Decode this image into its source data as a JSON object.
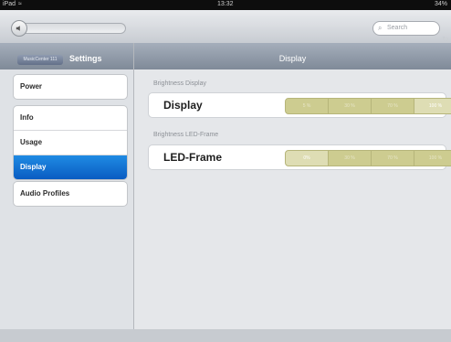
{
  "status_bar": {
    "device": "iPad",
    "wifi_icon": "wifi-icon",
    "time": "13:32",
    "battery": "34%"
  },
  "toolbar": {
    "search_placeholder": "Search",
    "speaker_icon": "speaker-icon"
  },
  "sidebar": {
    "back_label": "MusicCenter 111",
    "title": "Settings",
    "groups": [
      [
        "Power"
      ],
      [
        "Info",
        "Usage",
        "Display"
      ],
      [
        "Audio Profiles"
      ]
    ],
    "active_item": "Display"
  },
  "main": {
    "title": "Display",
    "sections": [
      {
        "label": "Brightness Display",
        "card_title": "Display",
        "options": [
          "5 %",
          "30 %",
          "70 %",
          "100 %"
        ],
        "selected": "100 %"
      },
      {
        "label": "Brightness LED-Frame",
        "card_title": "LED-Frame",
        "options": [
          "0%",
          "30 %",
          "70 %",
          "100 %"
        ],
        "selected": "0%"
      }
    ]
  },
  "colors": {
    "accent": "#0a6fd6",
    "segment": "#cdcc90",
    "header": "#8e99a8"
  }
}
